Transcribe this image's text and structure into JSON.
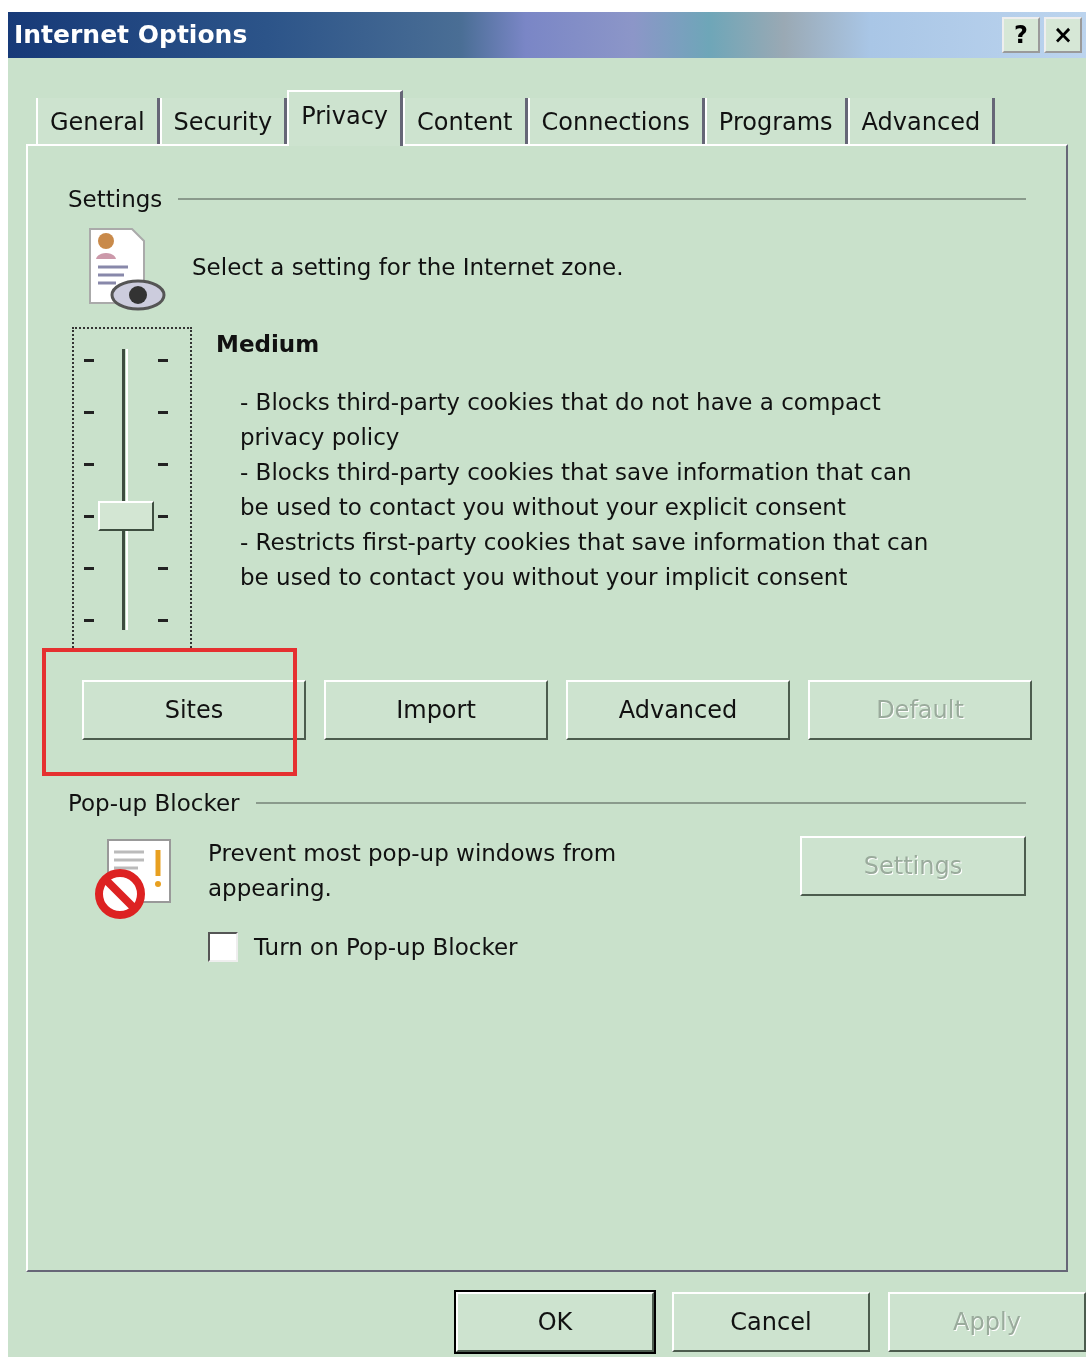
{
  "window": {
    "title": "Internet Options",
    "title_buttons": [
      "?",
      "×"
    ]
  },
  "tabs": [
    {
      "label": "General",
      "selected": false
    },
    {
      "label": "Security",
      "selected": false
    },
    {
      "label": "Privacy",
      "selected": true
    },
    {
      "label": "Content",
      "selected": false
    },
    {
      "label": "Connections",
      "selected": false
    },
    {
      "label": "Programs",
      "selected": false
    },
    {
      "label": "Advanced",
      "selected": false
    }
  ],
  "settings": {
    "heading": "Settings",
    "instruction": "Select a setting for the Internet zone.",
    "slider": {
      "level": 0.4
    },
    "level_name": "Medium",
    "description": [
      "- Blocks third-party cookies that do not have a compact privacy policy",
      "- Blocks third-party cookies that save information that can be used to contact you without your explicit consent",
      "- Restricts first-party cookies that save information that can be used to contact you without your implicit consent"
    ],
    "buttons": [
      {
        "label": "Sites",
        "disabled": false,
        "highlighted": true
      },
      {
        "label": "Import",
        "disabled": false,
        "highlighted": false
      },
      {
        "label": "Advanced",
        "disabled": false,
        "highlighted": false
      },
      {
        "label": "Default",
        "disabled": true,
        "highlighted": false
      }
    ]
  },
  "popup_blocker": {
    "heading": "Pop-up Blocker",
    "description": "Prevent most pop-up windows from appearing.",
    "settings_button": {
      "label": "Settings",
      "disabled": true
    },
    "checkbox": {
      "label": "Turn on Pop-up Blocker",
      "checked": false
    }
  },
  "footer_buttons": [
    {
      "label": "OK",
      "disabled": false,
      "default": true
    },
    {
      "label": "Cancel",
      "disabled": false,
      "default": false
    },
    {
      "label": "Apply",
      "disabled": true,
      "default": false
    }
  ]
}
